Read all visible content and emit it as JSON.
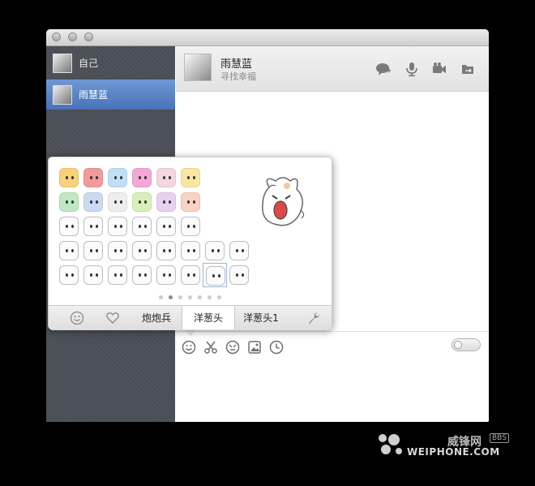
{
  "window": {
    "traffic_lights": [
      "close",
      "minimize",
      "zoom"
    ]
  },
  "sidebar": {
    "items": [
      {
        "label": "自己",
        "selected": false
      },
      {
        "label": "雨慧蓝",
        "selected": true
      }
    ]
  },
  "chat": {
    "contact_name": "雨慧蓝",
    "contact_status": "寻找幸福",
    "header_icons": [
      "chat-add-icon",
      "microphone-icon",
      "video-camera-icon",
      "file-transfer-icon"
    ]
  },
  "emoji_panel": {
    "rows": 5,
    "cols": 8,
    "pages": 7,
    "active_page": 2,
    "tabs": [
      {
        "kind": "icon",
        "icon": "smiley-icon",
        "label": ""
      },
      {
        "kind": "icon",
        "icon": "heart-icon",
        "label": ""
      },
      {
        "kind": "text",
        "label": "炮炮兵",
        "active": false
      },
      {
        "kind": "text",
        "label": "洋葱头",
        "active": true
      },
      {
        "kind": "text",
        "label": "洋葱头1",
        "active": false
      },
      {
        "kind": "icon",
        "icon": "wrench-icon",
        "label": ""
      }
    ]
  },
  "input_toolbar": {
    "icons": [
      "smiley-icon",
      "scissors-icon",
      "shake-icon",
      "image-icon",
      "history-clock-icon"
    ],
    "toggle_state": "off"
  },
  "watermark": {
    "cn": "威锋网",
    "bbs": "BBS",
    "en": "WEIPHONE.COM"
  }
}
